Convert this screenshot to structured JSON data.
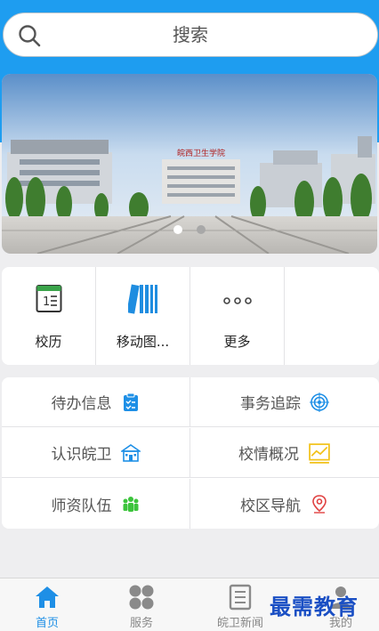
{
  "search": {
    "placeholder": "搜索"
  },
  "banner": {
    "sign_text": "皖西卫生学院",
    "slide_count": 2,
    "active_slide": 1
  },
  "apps": [
    {
      "label": "校历",
      "icon": "calendar-icon"
    },
    {
      "label": "移动图...",
      "icon": "books-icon"
    },
    {
      "label": "更多",
      "icon": "more-icon"
    }
  ],
  "info": [
    {
      "label": "待办信息",
      "icon": "todo-clipboard-icon",
      "color": "#1e8fe6"
    },
    {
      "label": "事务追踪",
      "icon": "target-icon",
      "color": "#1e8fe6"
    },
    {
      "label": "认识皖卫",
      "icon": "school-building-icon",
      "color": "#1e8fe6"
    },
    {
      "label": "校情概况",
      "icon": "trend-chart-icon",
      "color": "#f2c21a"
    },
    {
      "label": "师资队伍",
      "icon": "team-icon",
      "color": "#3cc43c"
    },
    {
      "label": "校区导航",
      "icon": "location-pin-icon",
      "color": "#e04040"
    }
  ],
  "tabs": [
    {
      "label": "首页",
      "icon": "home-icon",
      "active": true
    },
    {
      "label": "服务",
      "icon": "services-icon",
      "active": false
    },
    {
      "label": "皖卫新闻",
      "icon": "news-icon",
      "active": false
    },
    {
      "label": "我的",
      "icon": "profile-icon",
      "active": false
    }
  ],
  "watermark": "最需教育",
  "colors": {
    "primary": "#1e9df0",
    "active_tab": "#1e8fe6",
    "inactive_tab": "#888888"
  }
}
